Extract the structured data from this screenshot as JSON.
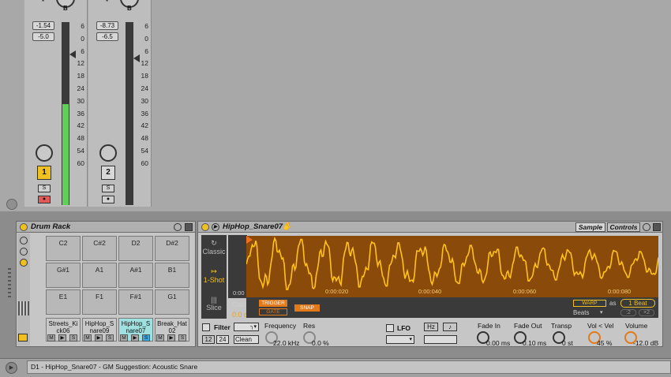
{
  "colors": {
    "accent": "#f0c020",
    "waveform_bg": "#8a4a0a",
    "waveform_line": "#ffc21a",
    "meter": "#5fcf5a",
    "solo_active": "#37a8e0"
  },
  "mixer": {
    "tracks": [
      {
        "knob_label": "B",
        "volume": "-1.54",
        "peak": "-5.0",
        "number": "1",
        "solo": "S",
        "meter_level": 0.55,
        "active": true
      },
      {
        "knob_label": "B",
        "volume": "-8.73",
        "peak": "-6.5",
        "number": "2",
        "solo": "S",
        "meter_level": 0.0,
        "active": false
      }
    ],
    "scale": [
      "6",
      "0",
      "6",
      "12",
      "18",
      "24",
      "30",
      "36",
      "42",
      "48",
      "54",
      "60"
    ]
  },
  "drum_rack": {
    "title": "Drum Rack",
    "pads": [
      [
        "C2",
        "C#2",
        "D2",
        "D#2"
      ],
      [
        "G#1",
        "A1",
        "A#1",
        "B1"
      ],
      [
        "E1",
        "F1",
        "F#1",
        "G1"
      ]
    ],
    "cells": [
      {
        "line1": "Streets_Ki",
        "line2": "ck06"
      },
      {
        "line1": "HipHop_S",
        "line2": "nare09"
      },
      {
        "line1": "HipHop_S",
        "line2": "nare07"
      },
      {
        "line1": "Break_Hat",
        "line2": "02"
      }
    ],
    "cell_btns": {
      "m": "M",
      "play": "▶",
      "s": "S"
    }
  },
  "simpler": {
    "title": "HipHop_Snare07",
    "tabs": {
      "sample": "Sample",
      "controls": "Controls"
    },
    "modes": {
      "classic": "Classic",
      "one_shot": "1-Shot",
      "slice": "Slice"
    },
    "gain_label": "Gain",
    "gain_value": "0.0 dB",
    "trigger": "TRIGGER",
    "gate": "GATE",
    "snap": "SNAP",
    "time_ticks": [
      "0:00",
      "0:00:020",
      "0:00:040",
      "0:00:060",
      "0:00:080"
    ],
    "warp": "WARP",
    "as": "as",
    "beat": "1 Beat",
    "beats": "Beats",
    "half": ":2",
    "double": "×2",
    "filter": {
      "label": "Filter",
      "freq_label": "Frequency",
      "freq_value": "22.0 kHz",
      "res_label": "Res",
      "res_value": "0.0 %",
      "btn12": "12",
      "btn24": "24",
      "clean": "Clean"
    },
    "lfo": {
      "label": "LFO",
      "hz": "Hz",
      "note": "♪"
    },
    "fade_in": {
      "label": "Fade In",
      "value": "0.00 ms"
    },
    "fade_out": {
      "label": "Fade Out",
      "value": "0.10 ms"
    },
    "transp": {
      "label": "Transp",
      "value": "0 st"
    },
    "vol_vel": {
      "label": "Vol < Vel",
      "value": "45 %",
      "level": 0.45
    },
    "volume": {
      "label": "Volume",
      "value": "-12.0 dB"
    }
  },
  "status": {
    "text": "D1 - HipHop_Snare07 - GM Suggestion: Acoustic Snare"
  }
}
